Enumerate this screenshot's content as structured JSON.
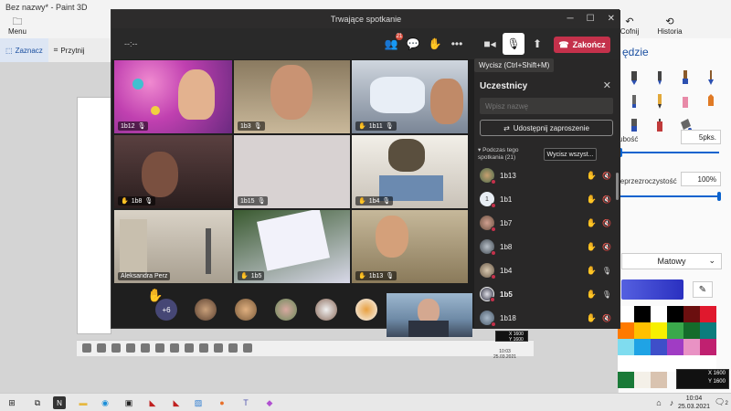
{
  "paint3d": {
    "title": "Bez nazwy* - Paint 3D",
    "menu_label": "Menu",
    "select_label": "Zaznacz",
    "crop_label": "Przytnij",
    "undo_label": "Cofnij",
    "history_label": "Historia",
    "panel_title": "ędzie",
    "thickness_label": "ubość",
    "thickness_value": "5pks.",
    "opacity_label": "ieprzezroczystość",
    "opacity_value": "100%",
    "finish_value": "Matowy",
    "palette": [
      "#ffffff",
      "#000000",
      "#ffffff",
      "#000000",
      "#6b0f0f",
      "#e0182d",
      "#ff7a00",
      "#ffc000",
      "#f7f000",
      "#3aa84b",
      "#146c2b",
      "#0b7d7d",
      "#7fdcef",
      "#1fa3e5",
      "#3e4fc9",
      "#a03cc4",
      "#e992c4",
      "#c02070",
      "#ffffff",
      "#ffffff",
      "#ffffff",
      "#ffffff",
      "#ffffff",
      "#ffffff",
      "#1a7a38",
      "#f4f0e8",
      "#d9c3b0"
    ]
  },
  "teams": {
    "window_title": "Trwające spotkanie",
    "timer": "--:--",
    "participants_badge": "21",
    "leave_label": "Zakończ",
    "mute_tooltip": "Wycisz (Ctrl+Shift+M)",
    "tiles": [
      {
        "label": "1b12",
        "hand": false
      },
      {
        "label": "1b3",
        "hand": false
      },
      {
        "label": "1b11",
        "hand": true
      },
      {
        "label": "1b8",
        "hand": true
      },
      {
        "label": "1b15",
        "hand": false
      },
      {
        "label": "1b4",
        "hand": true
      },
      {
        "label": "Aleksandra Perz",
        "hand": false
      },
      {
        "label": "1b5",
        "hand": true
      },
      {
        "label": "1b13",
        "hand": true
      }
    ],
    "overflow_count": "+6",
    "panel": {
      "title": "Uczestnicy",
      "search_placeholder": "Wpisz nazwę",
      "share_label": "Udostępnij zaproszenie",
      "section_label": "Podczas tego spotkania (21)",
      "mute_all_label": "Wycisz wszyst...",
      "participants": [
        {
          "name": "1b13",
          "mic": "muted"
        },
        {
          "name": "1b1",
          "mic": "muted"
        },
        {
          "name": "1b7",
          "mic": "muted"
        },
        {
          "name": "1b8",
          "mic": "muted"
        },
        {
          "name": "1b4",
          "mic": "on"
        },
        {
          "name": "1b5",
          "mic": "on"
        },
        {
          "name": "1b18",
          "mic": "muted"
        }
      ]
    }
  },
  "taskbar": {
    "time": "10:04",
    "date": "25.03.2021",
    "notif_count": "2"
  },
  "overlay": {
    "coords_x": "X 1600",
    "coords_y": "Y 1600",
    "mini_x": "X 1600",
    "mini_y": "Y 1600",
    "mini_time": "10:03",
    "mini_date": "25.03.2021"
  }
}
